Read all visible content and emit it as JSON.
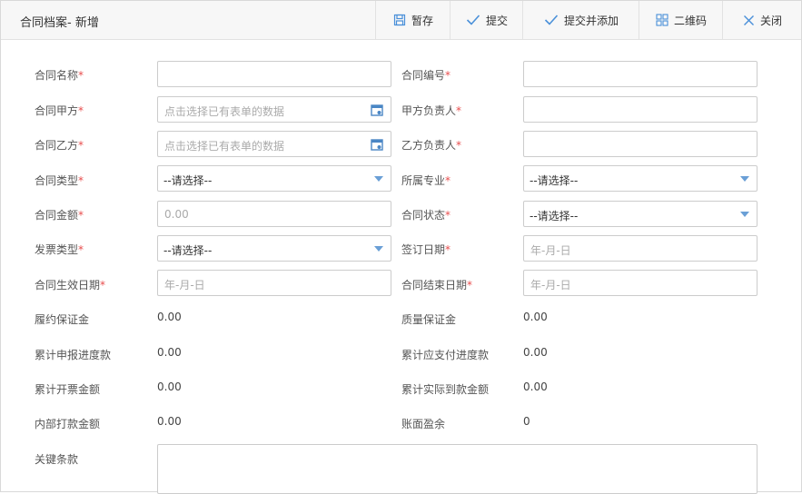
{
  "header": {
    "title": "合同档案- 新增",
    "buttons": {
      "save": "暂存",
      "submit": "提交",
      "submit_add": "提交并添加",
      "qrcode": "二维码",
      "close": "关闭"
    }
  },
  "form": {
    "required_mark": "*",
    "contract_name": {
      "label": "合同名称",
      "value": ""
    },
    "contract_no": {
      "label": "合同编号",
      "value": ""
    },
    "party_a": {
      "label": "合同甲方",
      "placeholder": "点击选择已有表单的数据"
    },
    "party_a_contact": {
      "label": "甲方负责人",
      "value": ""
    },
    "party_b": {
      "label": "合同乙方",
      "placeholder": "点击选择已有表单的数据"
    },
    "party_b_contact": {
      "label": "乙方负责人",
      "value": ""
    },
    "contract_type": {
      "label": "合同类型",
      "selected": "--请选择--"
    },
    "major": {
      "label": "所属专业",
      "selected": "--请选择--"
    },
    "amount": {
      "label": "合同金额",
      "placeholder": "0.00"
    },
    "status": {
      "label": "合同状态",
      "selected": "--请选择--"
    },
    "invoice_type": {
      "label": "发票类型",
      "selected": "--请选择--"
    },
    "sign_date": {
      "label": "签订日期",
      "placeholder": "年-月-日"
    },
    "effective_date": {
      "label": "合同生效日期",
      "placeholder": "年-月-日"
    },
    "end_date": {
      "label": "合同结束日期",
      "placeholder": "年-月-日"
    },
    "performance_bond": {
      "label": "履约保证金",
      "value": "0.00"
    },
    "quality_bond": {
      "label": "质量保证金",
      "value": "0.00"
    },
    "declared_progress": {
      "label": "累计申报进度款",
      "value": "0.00"
    },
    "payable_progress": {
      "label": "累计应支付进度款",
      "value": "0.00"
    },
    "invoiced_amount": {
      "label": "累计开票金额",
      "value": "0.00"
    },
    "received_amount": {
      "label": "累计实际到款金额",
      "value": "0.00"
    },
    "internal_payment": {
      "label": "内部打款金额",
      "value": "0.00"
    },
    "book_surplus": {
      "label": "账面盈余",
      "value": "0"
    },
    "key_terms": {
      "label": "关键条款",
      "value": ""
    }
  },
  "colors": {
    "required": "#e84d4d",
    "accent": "#4a90d9",
    "caret": "#6a9fd6"
  }
}
